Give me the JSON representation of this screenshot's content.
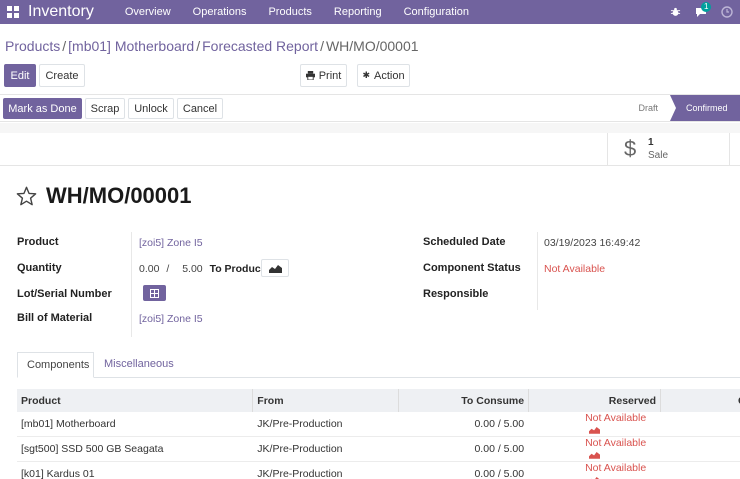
{
  "navbar": {
    "brand": "Inventory",
    "menu": [
      "Overview",
      "Operations",
      "Products",
      "Reporting",
      "Configuration"
    ],
    "chat_badge": "1"
  },
  "breadcrumb": {
    "items": [
      "Products",
      "[mb01] Motherboard",
      "Forecasted Report"
    ],
    "current": "WH/MO/00001"
  },
  "buttons": {
    "edit": "Edit",
    "create": "Create",
    "print": "Print",
    "action": "Action",
    "mark_done": "Mark as Done",
    "scrap": "Scrap",
    "unlock": "Unlock",
    "cancel": "Cancel"
  },
  "stages": {
    "draft": "Draft",
    "confirmed": "Confirmed"
  },
  "smart_button": {
    "count": "1",
    "label": "Sale"
  },
  "record": {
    "title": "WH/MO/00001",
    "labels": {
      "product": "Product",
      "quantity": "Quantity",
      "lot": "Lot/Serial Number",
      "bom": "Bill of Material",
      "scheduled": "Scheduled Date",
      "component_status": "Component Status",
      "responsible": "Responsible"
    },
    "product": "[zoi5] Zone I5",
    "qty_done": "0.00",
    "qty_sep": "/",
    "qty_total": "5.00",
    "to_produce": "To Produce",
    "bom": "[zoi5] Zone I5",
    "scheduled_date": "03/19/2023 16:49:42",
    "component_status": "Not Available"
  },
  "tabs": [
    "Components",
    "Miscellaneous"
  ],
  "table": {
    "headers": [
      "Product",
      "From",
      "To Consume",
      "Reserved",
      "Co"
    ],
    "rows": [
      {
        "product": "[mb01] Motherboard",
        "from": "JK/Pre-Production",
        "consume": "0.00 / 5.00",
        "reserved": "Not Available"
      },
      {
        "product": "[sgt500] SSD 500 GB Seagata",
        "from": "JK/Pre-Production",
        "consume": "0.00 / 5.00",
        "reserved": "Not Available"
      },
      {
        "product": "[k01] Kardus 01",
        "from": "JK/Pre-Production",
        "consume": "0.00 / 5.00",
        "reserved": "Not Available"
      }
    ]
  },
  "colors": {
    "brand": "#71639e",
    "danger": "#d9534f",
    "teal": "#00a09d"
  },
  "icons": [
    "apps-grid-icon",
    "bug-icon",
    "chat-icon",
    "clock-icon",
    "star-icon",
    "print-icon",
    "gear-icon",
    "dollar-icon",
    "forecast-chart-icon",
    "lot-add-icon"
  ]
}
